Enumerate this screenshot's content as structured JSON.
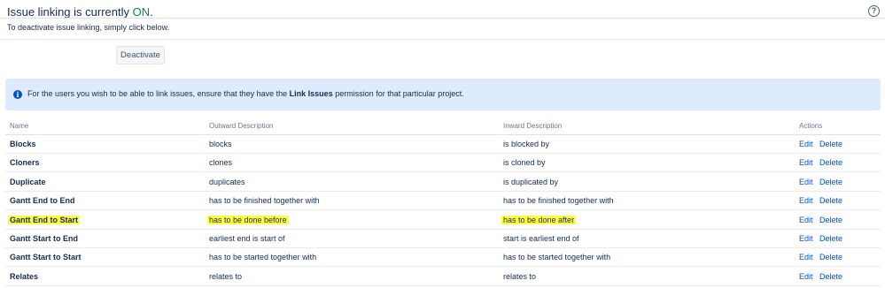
{
  "header": {
    "title_prefix": "Issue linking is currently ",
    "title_status": "ON",
    "title_suffix": ".",
    "help_icon": "question-circle-icon",
    "subtitle": "To deactivate issue linking, simply click below.",
    "deactivate_label": "Deactivate"
  },
  "info": {
    "icon": "info-icon",
    "text_before": "For the users you wish to be able to link issues, ensure that they have the ",
    "text_bold": "Link Issues",
    "text_after": " permission for that particular project."
  },
  "table": {
    "columns": {
      "name": "Name",
      "outward": "Outward Description",
      "inward": "Inward Description",
      "actions": "Actions"
    },
    "edit_label": "Edit",
    "delete_label": "Delete",
    "rows": [
      {
        "name": "Blocks",
        "outward": "blocks",
        "inward": "is blocked by"
      },
      {
        "name": "Cloners",
        "outward": "clones",
        "inward": "is cloned by"
      },
      {
        "name": "Duplicate",
        "outward": "duplicates",
        "inward": "is duplicated by"
      },
      {
        "name": "Gantt End to End",
        "outward": "has to be finished together with",
        "inward": "has to be finished together with"
      },
      {
        "name": "Gantt End to Start",
        "outward": "has to be done before",
        "inward": "has to be done after",
        "highlighted": true
      },
      {
        "name": "Gantt Start to End",
        "outward": "earliest end is start of",
        "inward": "start is earliest end of"
      },
      {
        "name": "Gantt Start to Start",
        "outward": "has to be started together with",
        "inward": "has to be started together with"
      },
      {
        "name": "Relates",
        "outward": "relates to",
        "inward": "relates to"
      }
    ]
  },
  "colors": {
    "status_on": "#00875a",
    "link": "#0052cc",
    "info_bg": "#deebff",
    "highlight": "#ffff40"
  }
}
